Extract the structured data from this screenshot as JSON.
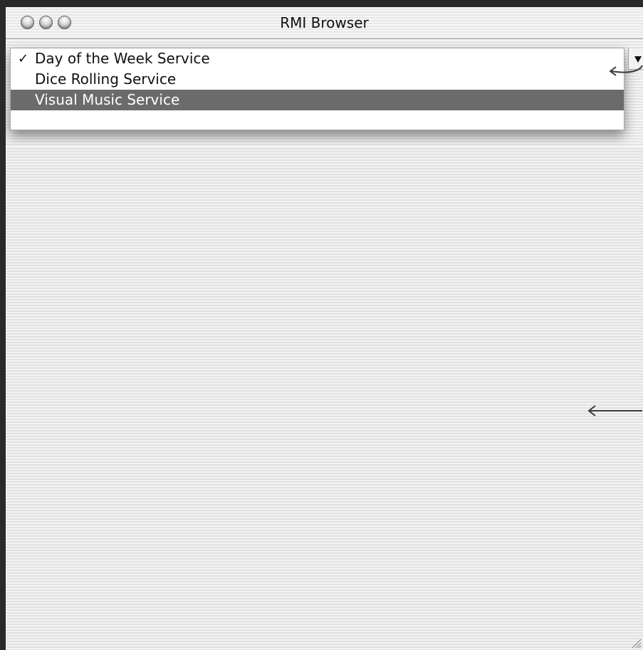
{
  "window": {
    "title": "RMI Browser"
  },
  "menu": {
    "items": [
      {
        "label": "Day of the Week Service",
        "checked": true,
        "highlighted": false
      },
      {
        "label": "Dice Rolling Service",
        "checked": false,
        "highlighted": false
      },
      {
        "label": "Visual Music Service",
        "checked": false,
        "highlighted": true
      }
    ],
    "check_glyph": "✓"
  },
  "colors": {
    "highlight": "#6b6b6b",
    "text": "#111111"
  },
  "icons": {
    "close": "close-icon",
    "minimize": "minimize-icon",
    "zoom": "zoom-icon",
    "dropdown": "chevron-down-icon",
    "resize": "resize-grip-icon",
    "annotation": "arrow-left-icon"
  }
}
